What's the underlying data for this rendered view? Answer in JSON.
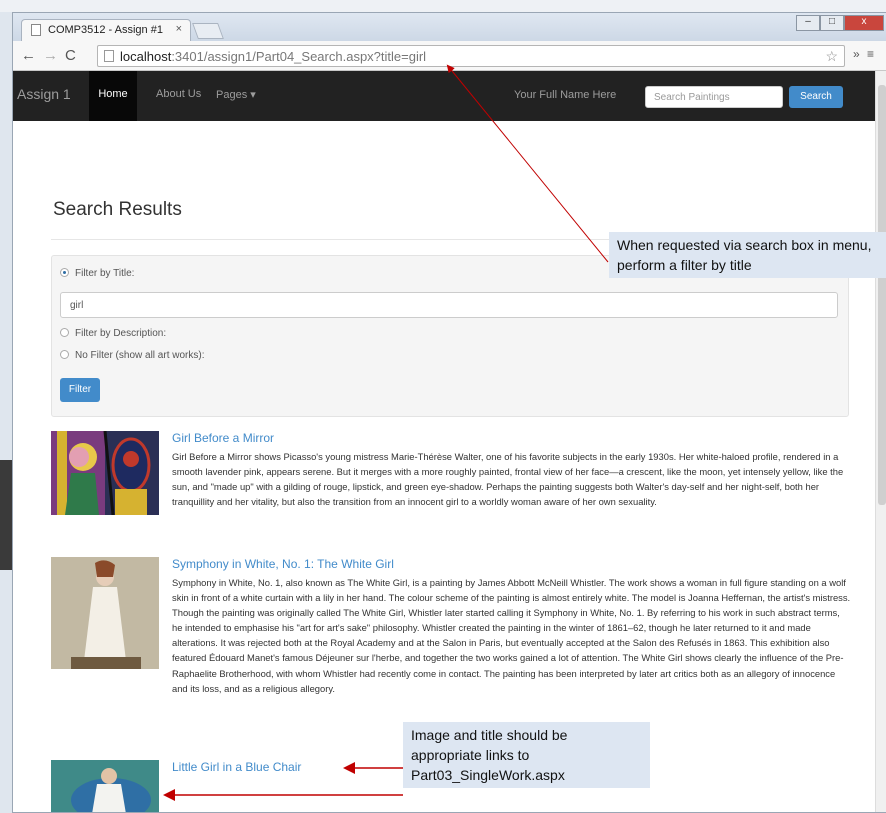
{
  "browser": {
    "tab_title": "COMP3512 - Assign #1",
    "tab_close": "×",
    "url_host": "localhost",
    "url_rest": ":3401/assign1/Part04_Search.aspx?title=girl",
    "win_min": "–",
    "win_max": "□",
    "win_close": "x"
  },
  "navbar": {
    "brand": "Assign 1",
    "home": "Home",
    "about": "About Us",
    "pages": "Pages ▾",
    "user_name": "Your Full Name Here",
    "search_placeholder": "Search Paintings",
    "search_button": "Search"
  },
  "page": {
    "heading": "Search Results"
  },
  "filter": {
    "option_title": "Filter by Title:",
    "title_value": "girl",
    "option_description": "Filter by Description:",
    "option_none": "No Filter (show all art works):",
    "button": "Filter"
  },
  "results": [
    {
      "title": "Girl Before a Mirror",
      "description": "Girl Before a Mirror shows Picasso's young mistress Marie-Thérèse Walter, one of his favorite subjects in the early 1930s. Her white-haloed profile, rendered in a smooth lavender pink, appears serene. But it merges with a more roughly painted, frontal view of her face—a crescent, like the moon, yet intensely yellow, like the sun, and \"made up\" with a gilding of rouge, lipstick, and green eye-shadow. Perhaps the painting suggests both Walter's day-self and her night-self, both her tranquillity and her vitality, but also the transition from an innocent girl to a worldly woman aware of her own sexuality."
    },
    {
      "title": "Symphony in White, No. 1: The White Girl",
      "description": "Symphony in White, No. 1, also known as The White Girl, is a painting by James Abbott McNeill Whistler. The work shows a woman in full figure standing on a wolf skin in front of a white curtain with a lily in her hand. The colour scheme of the painting is almost entirely white. The model is Joanna Heffernan, the artist's mistress. Though the painting was originally called The White Girl, Whistler later started calling it Symphony in White, No. 1. By referring to his work in such abstract terms, he intended to emphasise his \"art for art's sake\" philosophy. Whistler created the painting in the winter of 1861–62, though he later returned to it and made alterations. It was rejected both at the Royal Academy and at the Salon in Paris, but eventually accepted at the Salon des Refusés in 1863. This exhibition also featured Édouard Manet's famous Déjeuner sur l'herbe, and together the two works gained a lot of attention. The White Girl shows clearly the influence of the Pre-Raphaelite Brotherhood, with whom Whistler had recently come in contact. The painting has been interpreted by later art critics both as an allegory of innocence and its loss, and as a religious allegory."
    },
    {
      "title": "Little Girl in a Blue Chair",
      "description": ""
    }
  ],
  "callouts": {
    "search": "When requested via search box in menu, perform a filter by title",
    "links": "Image and title should be appropriate links to Part03_SingleWork.aspx"
  },
  "colors": {
    "navbar_bg": "#222222",
    "link": "#428bca",
    "primary_button": "#428bca",
    "callout_bg": "#dde6f2",
    "arrow": "#c00000"
  }
}
